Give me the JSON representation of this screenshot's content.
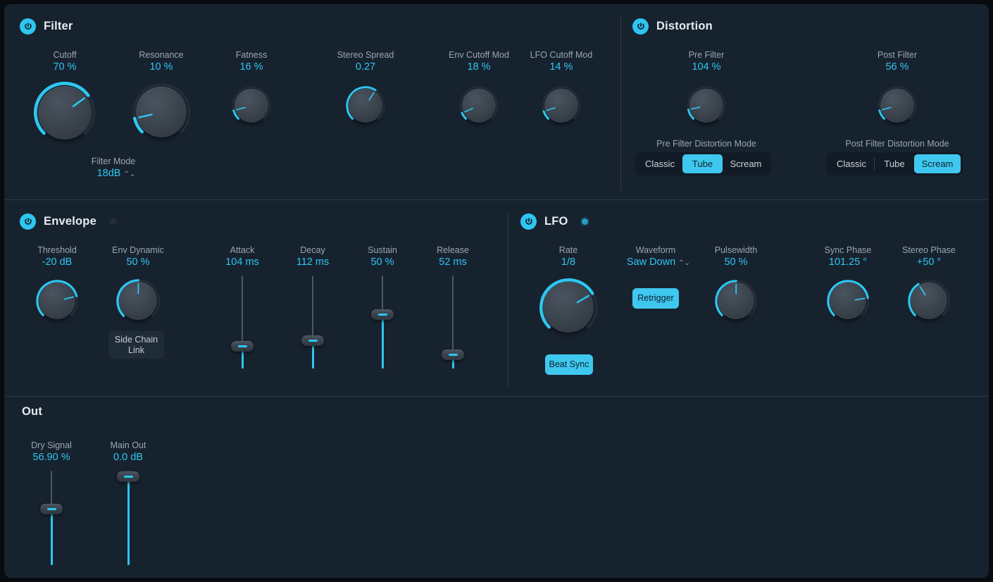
{
  "plugin": {
    "accent": "#2ec6f0",
    "panel_bg": "#17222f"
  },
  "filter": {
    "title": "Filter",
    "power_icon": "power-icon",
    "knobs": [
      {
        "label": "Cutoff",
        "value": "70 %",
        "pct": 0.7
      },
      {
        "label": "Resonance",
        "value": "10 %",
        "pct": 0.1
      },
      {
        "label": "Fatness",
        "value": "16 %",
        "pct": 0.16
      },
      {
        "label": "Stereo Spread",
        "value": "0.27",
        "pct": 0.62
      },
      {
        "label": "Env Cutoff Mod",
        "value": "18 %",
        "pct": 0.09
      },
      {
        "label": "LFO Cutoff Mod",
        "value": "14 %",
        "pct": 0.14
      }
    ],
    "filter_mode": {
      "label": "Filter Mode",
      "value": "18dB"
    }
  },
  "distortion": {
    "title": "Distortion",
    "power_icon": "power-icon",
    "knobs": [
      {
        "label": "Pre Filter",
        "value": "104 %",
        "pct": 0.17
      },
      {
        "label": "Post Filter",
        "value": "56 %",
        "pct": 0.14
      }
    ],
    "pre_mode": {
      "label": "Pre Filter Distortion Mode",
      "options": [
        "Classic",
        "Tube",
        "Scream"
      ],
      "selected": "Tube"
    },
    "post_mode": {
      "label": "Post Filter Distortion Mode",
      "options": [
        "Classic",
        "Tube",
        "Scream"
      ],
      "selected": "Scream"
    }
  },
  "envelope": {
    "title": "Envelope",
    "power_icon": "power-icon",
    "led": "off",
    "knobs": [
      {
        "label": "Threshold",
        "value": "-20 dB",
        "pct": 0.8
      },
      {
        "label": "Env Dynamic",
        "value": "50 %",
        "pct": 0.5
      }
    ],
    "side_chain_link": "Side Chain\nLink",
    "side_chain_line1": "Side Chain",
    "side_chain_line2": "Link",
    "sliders": [
      {
        "label": "Attack",
        "value": "104 ms",
        "pct": 0.22
      },
      {
        "label": "Decay",
        "value": "112 ms",
        "pct": 0.28
      },
      {
        "label": "Sustain",
        "value": "50 %",
        "pct": 0.55
      },
      {
        "label": "Release",
        "value": "52 ms",
        "pct": 0.13
      }
    ]
  },
  "lfo": {
    "title": "LFO",
    "power_icon": "power-icon",
    "led": "on",
    "rate": {
      "label": "Rate",
      "value": "1/8",
      "pct": 0.7
    },
    "waveform": {
      "label": "Waveform",
      "value": "Saw Down"
    },
    "retrigger": {
      "label": "Retrigger",
      "state": "on"
    },
    "beat_sync": {
      "label": "Beat Sync",
      "state": "on"
    },
    "pulsewidth": {
      "label": "Pulsewidth",
      "value": "50 %",
      "pct": 0.5
    },
    "sync_phase": {
      "label": "Sync Phase",
      "value": "101.25 °",
      "pct": 0.79
    },
    "stereo_phase": {
      "label": "Stereo Phase",
      "value": "+50 °",
      "pct": 0.35
    }
  },
  "out": {
    "title": "Out",
    "sliders": [
      {
        "label": "Dry Signal",
        "value": "56.90 %",
        "pct": 0.58
      },
      {
        "label": "Main Out",
        "value": "0.0 dB",
        "pct": 0.95
      }
    ]
  }
}
